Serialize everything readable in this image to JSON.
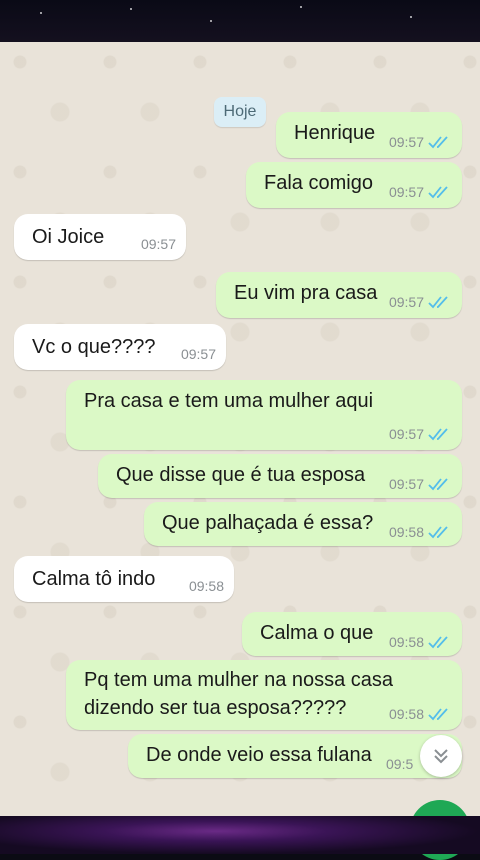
{
  "date_divider": "Hoje",
  "messages": [
    {
      "dir": "out",
      "text": "Henrique",
      "time": "09:57",
      "status": "read"
    },
    {
      "dir": "out",
      "text": "Fala comigo",
      "time": "09:57",
      "status": "read"
    },
    {
      "dir": "in",
      "text": "Oi Joice",
      "time": "09:57"
    },
    {
      "dir": "out",
      "text": "Eu vim pra casa",
      "time": "09:57",
      "status": "read"
    },
    {
      "dir": "in",
      "text": "Vc o que????",
      "time": "09:57"
    },
    {
      "dir": "out",
      "text": "Pra casa e tem uma mulher aqui",
      "time": "09:57",
      "status": "read"
    },
    {
      "dir": "out",
      "text": "Que disse que é tua esposa",
      "time": "09:57",
      "status": "read"
    },
    {
      "dir": "out",
      "text": "Que palhaçada é essa?",
      "time": "09:58",
      "status": "read"
    },
    {
      "dir": "in",
      "text": "Calma tô indo",
      "time": "09:58"
    },
    {
      "dir": "out",
      "text": "Calma o que",
      "time": "09:58",
      "status": "read"
    },
    {
      "dir": "out",
      "text": "Pq tem uma mulher na nossa casa dizendo ser tua esposa?????",
      "time": "09:58",
      "status": "read"
    },
    {
      "dir": "out",
      "text": "De onde veio essa fulana",
      "time": "09:5",
      "status": "read"
    }
  ],
  "colors": {
    "outgoing": "#dbf9c6",
    "incoming": "#ffffff",
    "read_tick": "#53bdeb",
    "chat_bg": "#e9e3d9"
  },
  "icons": {
    "read_status": "double-check-icon",
    "scroll_down": "chevron-double-down-icon"
  }
}
